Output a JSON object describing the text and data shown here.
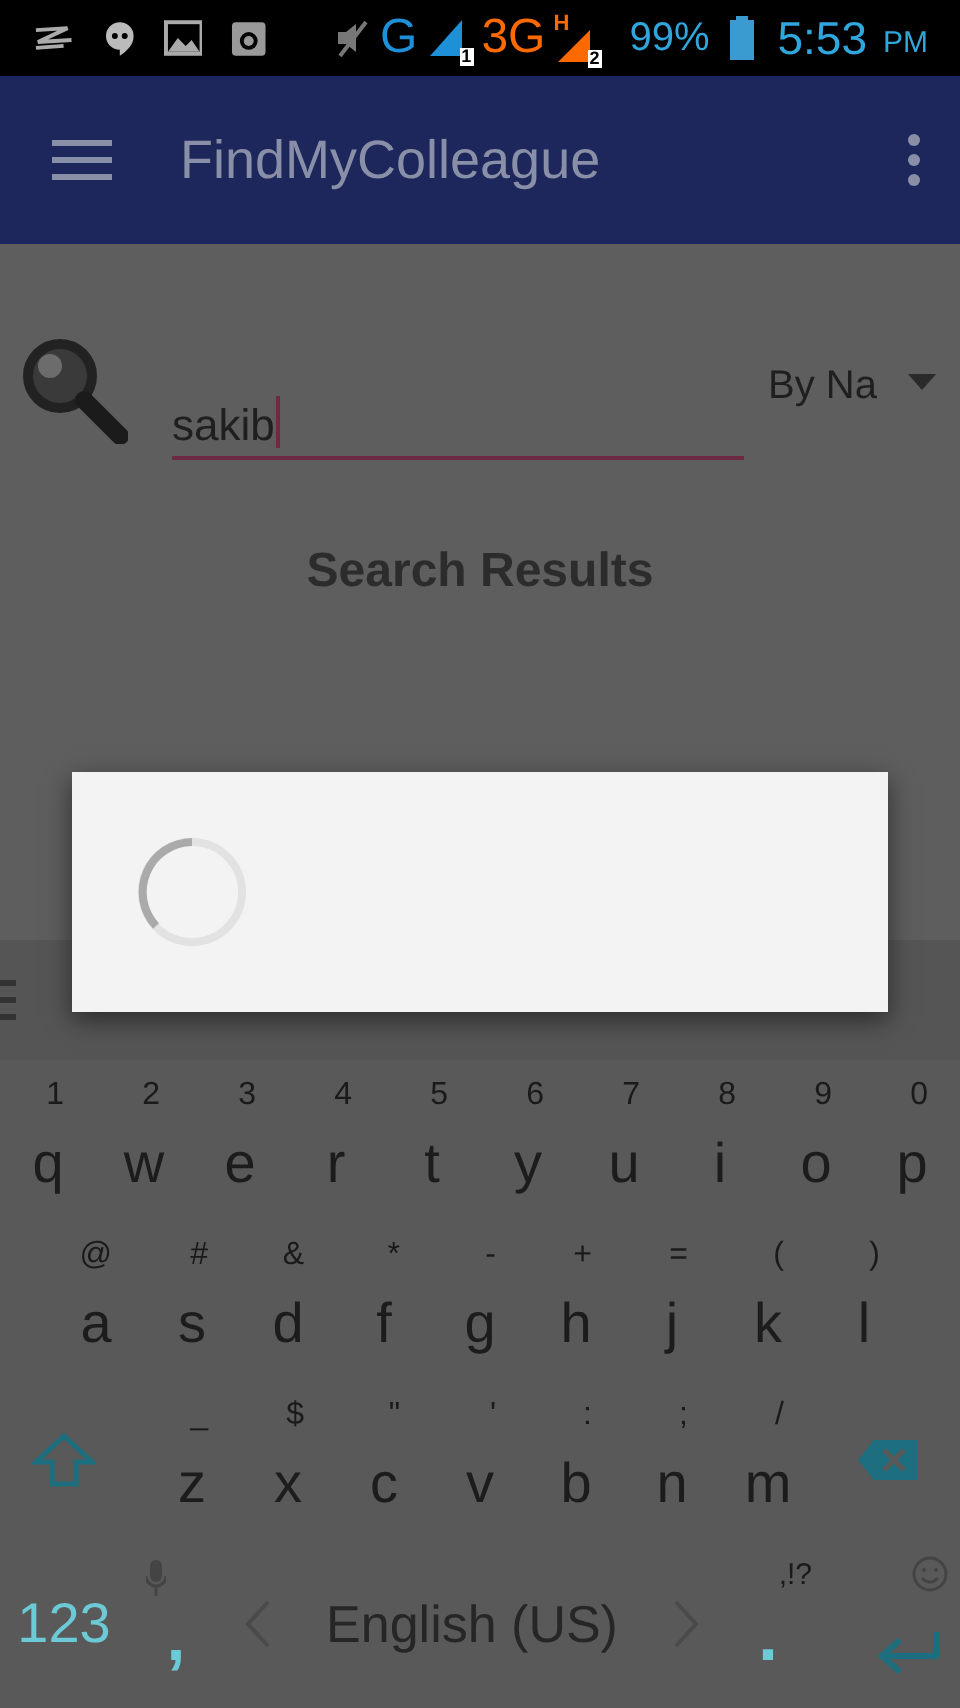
{
  "status_bar": {
    "network_1": "G",
    "sim_1": "1",
    "network_2": "3G",
    "network_2_type": "H",
    "sim_2": "2",
    "battery": "99%",
    "time": "5:53",
    "am_pm": "PM"
  },
  "app_bar": {
    "title": "FindMyColleague"
  },
  "search": {
    "value": "sakib",
    "filter": "By Na"
  },
  "results_title": "Search Results",
  "keyboard": {
    "rows": [
      [
        {
          "label": "q",
          "hint": "1"
        },
        {
          "label": "w",
          "hint": "2"
        },
        {
          "label": "e",
          "hint": "3"
        },
        {
          "label": "r",
          "hint": "4"
        },
        {
          "label": "t",
          "hint": "5"
        },
        {
          "label": "y",
          "hint": "6"
        },
        {
          "label": "u",
          "hint": "7"
        },
        {
          "label": "i",
          "hint": "8"
        },
        {
          "label": "o",
          "hint": "9"
        },
        {
          "label": "p",
          "hint": "0"
        }
      ],
      [
        {
          "label": "a",
          "hint": "@"
        },
        {
          "label": "s",
          "hint": "#"
        },
        {
          "label": "d",
          "hint": "&"
        },
        {
          "label": "f",
          "hint": "*"
        },
        {
          "label": "g",
          "hint": "-"
        },
        {
          "label": "h",
          "hint": "+"
        },
        {
          "label": "j",
          "hint": "="
        },
        {
          "label": "k",
          "hint": "("
        },
        {
          "label": "l",
          "hint": ")"
        }
      ],
      [
        {
          "label": "z",
          "hint": "_"
        },
        {
          "label": "x",
          "hint": "$"
        },
        {
          "label": "c",
          "hint": "\""
        },
        {
          "label": "v",
          "hint": "'"
        },
        {
          "label": "b",
          "hint": ":"
        },
        {
          "label": "n",
          "hint": ";"
        },
        {
          "label": "m",
          "hint": "/"
        }
      ]
    ],
    "symbols_key": "123",
    "comma_key": ",",
    "space_label": "English (US)",
    "period_key": ".",
    "period_hint": ",!?"
  }
}
